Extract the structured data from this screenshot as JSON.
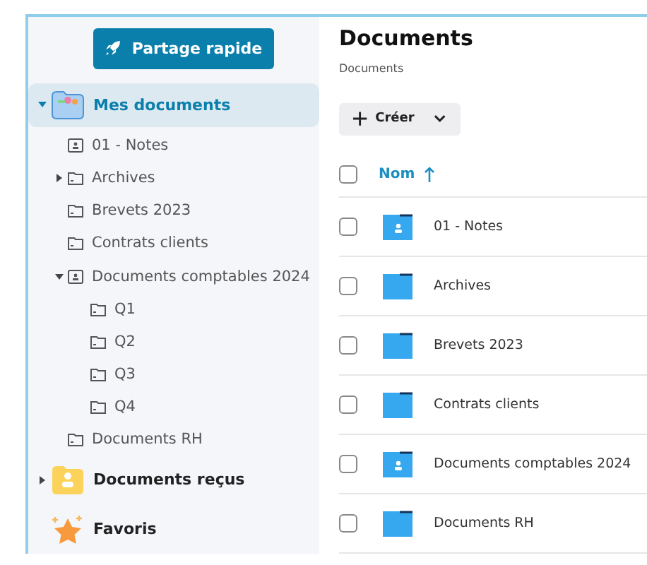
{
  "sidebar": {
    "share_button": "Partage rapide",
    "items": [
      {
        "label": "Mes documents",
        "kind": "my-documents",
        "selected": true,
        "expanded": true,
        "children": [
          {
            "label": "01 - Notes",
            "kind": "shared",
            "selected": false
          },
          {
            "label": "Archives",
            "kind": "folder",
            "selected": false,
            "expanded": false
          },
          {
            "label": "Brevets 2023",
            "kind": "folder",
            "selected": false
          },
          {
            "label": "Contrats clients",
            "kind": "folder",
            "selected": false
          },
          {
            "label": "Documents comptables 2024",
            "kind": "shared",
            "selected": false,
            "expanded": true,
            "children": [
              {
                "label": "Q1",
                "kind": "folder",
                "selected": false
              },
              {
                "label": "Q2",
                "kind": "folder",
                "selected": false
              },
              {
                "label": "Q3",
                "kind": "folder",
                "selected": false
              },
              {
                "label": "Q4",
                "kind": "folder",
                "selected": false
              }
            ]
          },
          {
            "label": "Documents RH",
            "kind": "folder",
            "selected": false
          }
        ]
      },
      {
        "label": "Documents reçus",
        "kind": "received",
        "selected": false,
        "expanded": false
      },
      {
        "label": "Favoris",
        "kind": "favorites",
        "selected": false
      }
    ]
  },
  "main": {
    "title": "Documents",
    "breadcrumb": "Documents",
    "create_button": "Créer",
    "table": {
      "name_column": "Nom",
      "sort_ascending": true,
      "header_checked": false,
      "rows": [
        {
          "name": "01 - Notes",
          "kind": "shared",
          "checked": false
        },
        {
          "name": "Archives",
          "kind": "folder",
          "checked": false
        },
        {
          "name": "Brevets 2023",
          "kind": "folder",
          "checked": false
        },
        {
          "name": "Contrats clients",
          "kind": "folder",
          "checked": false
        },
        {
          "name": "Documents comptables 2024",
          "kind": "shared",
          "checked": false
        },
        {
          "name": "Documents RH",
          "kind": "folder",
          "checked": false
        }
      ]
    }
  }
}
